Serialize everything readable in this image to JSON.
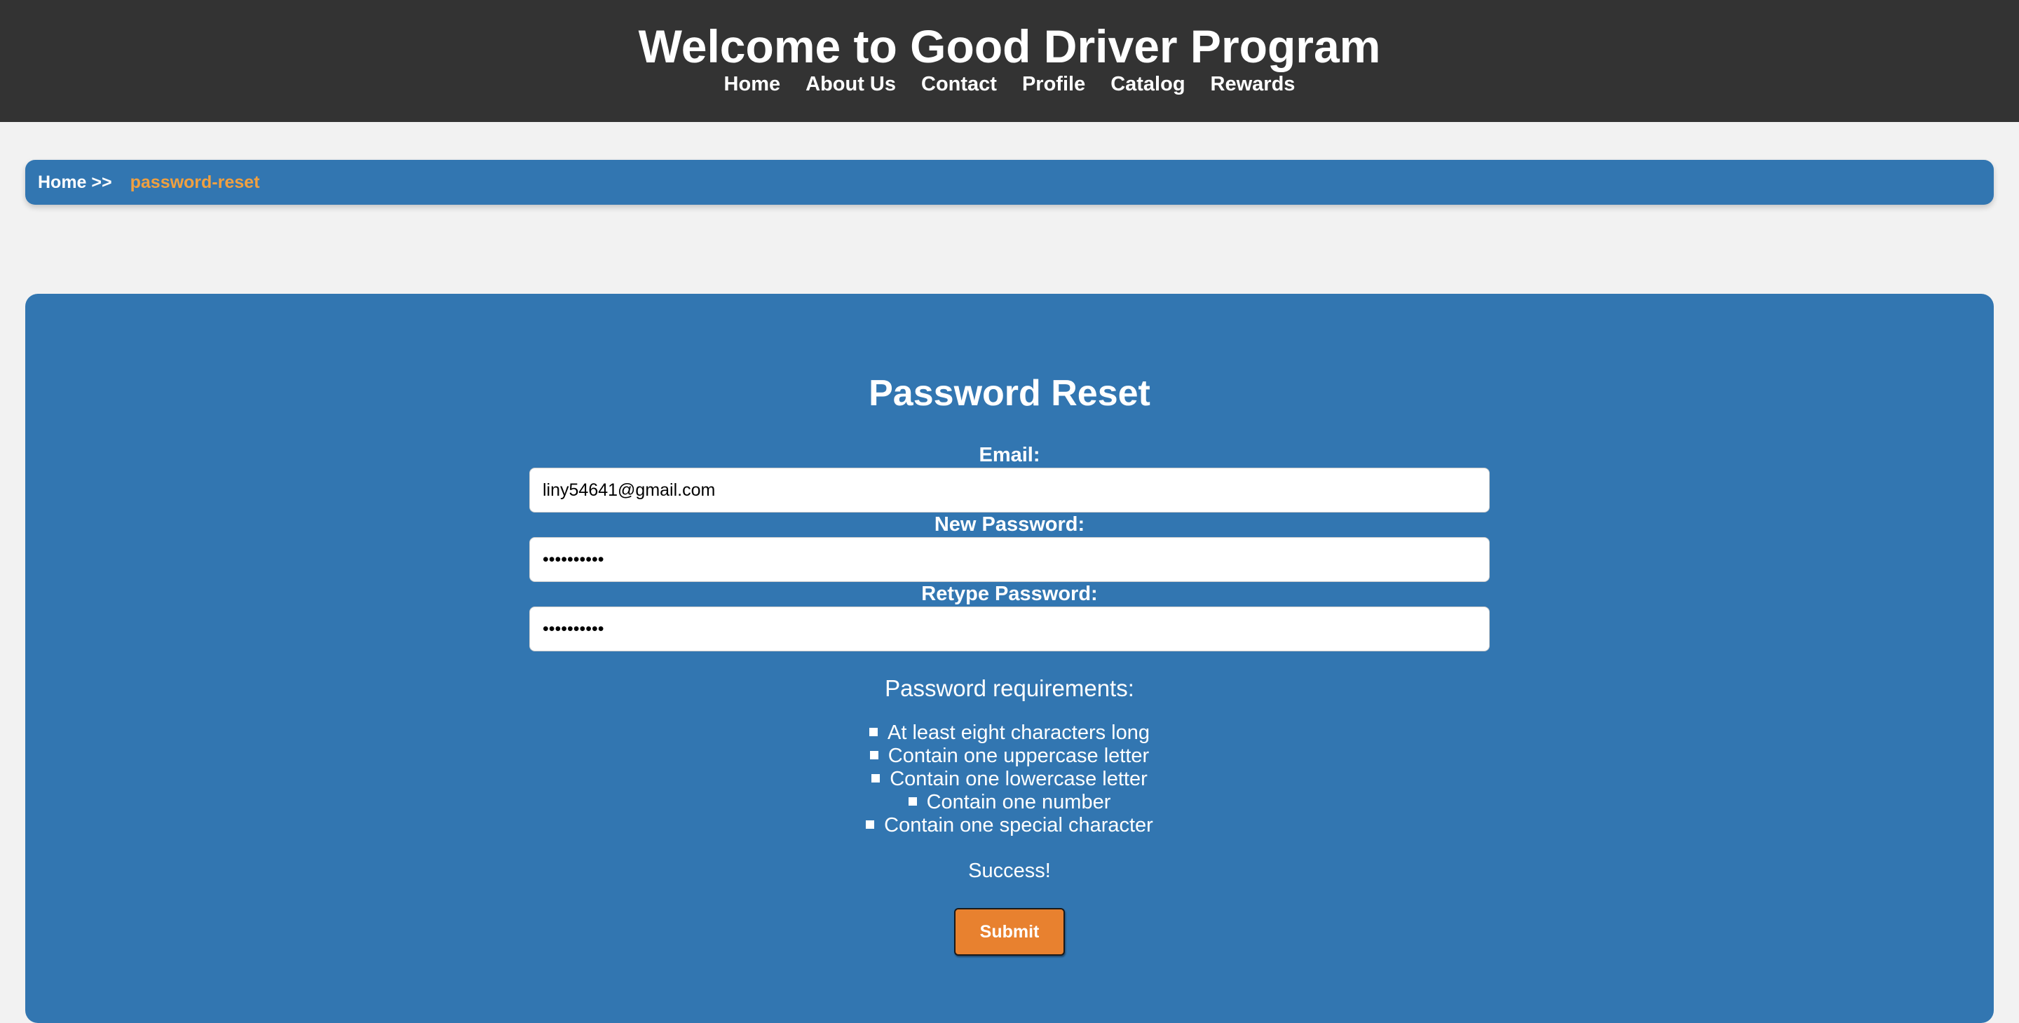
{
  "header": {
    "title": "Welcome to Good Driver Program",
    "nav": [
      "Home",
      "About Us",
      "Contact",
      "Profile",
      "Catalog",
      "Rewards"
    ]
  },
  "breadcrumb": {
    "home": "Home >>",
    "current": "password-reset"
  },
  "form": {
    "title": "Password Reset",
    "email_label": "Email:",
    "email_value": "liny54641@gmail.com",
    "new_password_label": "New Password:",
    "new_password_value": "••••••••••",
    "retype_password_label": "Retype Password:",
    "retype_password_value": "••••••••••",
    "requirements_title": "Password requirements:",
    "requirements": [
      "At least eight characters long",
      "Contain one uppercase letter",
      "Contain one lowercase letter",
      "Contain one number",
      "Contain one special character"
    ],
    "status": "Success!",
    "submit_label": "Submit"
  },
  "colors": {
    "header_bg": "#333333",
    "panel_bg": "#3276b1",
    "page_bg": "#f2f2f2",
    "accent": "#e8812f",
    "breadcrumb_current": "#f0a040"
  }
}
